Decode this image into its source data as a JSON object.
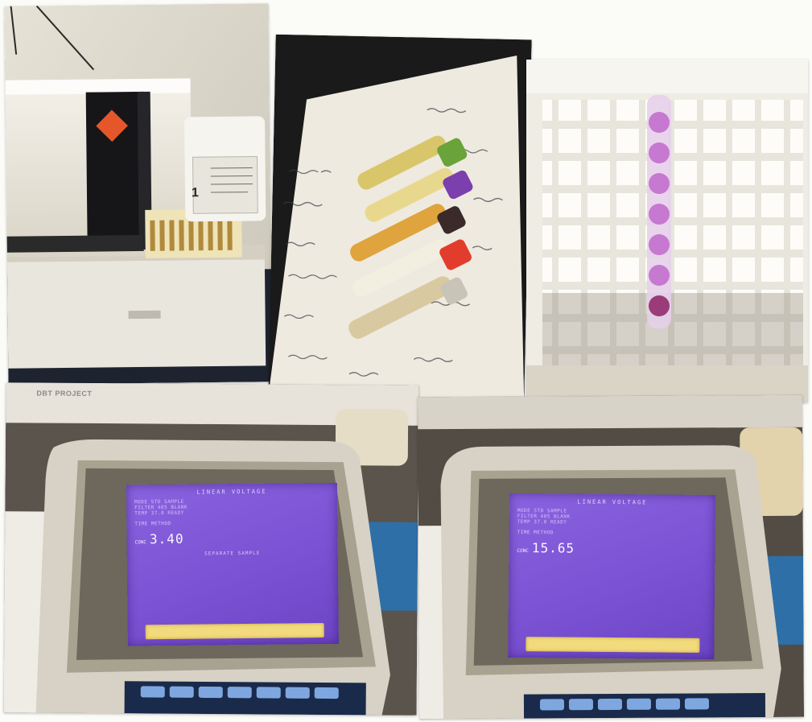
{
  "panels": [
    {
      "name": "analyzer",
      "label": "1"
    },
    {
      "name": "blood-tubes-on-paper"
    },
    {
      "name": "microplate-rack"
    },
    {
      "name": "analyzer-display-left",
      "sticker": "DBT PROJECT",
      "screen": {
        "title": "LINEAR VOLTAGE",
        "rows": [
          "MODE  STD     SAMPLE",
          "FILTER  405   BLANK",
          "TEMP   37.0  READY"
        ],
        "mid": "TIME   METHOD",
        "conc_label": "CONC",
        "conc_value": "3.40",
        "separator": "SEPARATE SAMPLE"
      }
    },
    {
      "name": "analyzer-display-right",
      "screen": {
        "title": "LINEAR VOLTAGE",
        "rows": [
          "MODE  STD     SAMPLE",
          "FILTER  405   BLANK",
          "TEMP   37.0  READY"
        ],
        "mid": "TIME   METHOD",
        "conc_label": "CONC",
        "conc_value": "15.65"
      }
    }
  ],
  "colors": {
    "lcd_purple": "#7a52d3",
    "lcd_bar_yellow": "#f2db7d",
    "analyzer_black": "#161618",
    "hazard_orange": "#e5572b",
    "tube_green": "#6aa33a",
    "tube_purple": "#7b3fae",
    "tube_red": "#e23c2c",
    "pink_sample": "#c778d0"
  }
}
